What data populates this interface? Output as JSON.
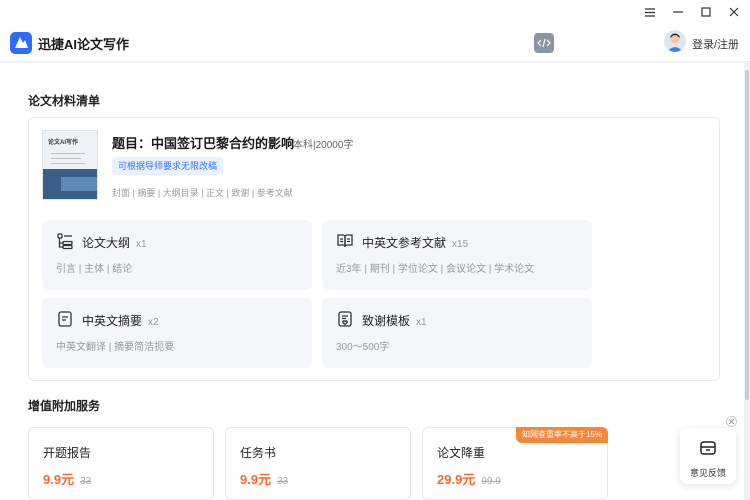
{
  "app": {
    "title": "迅捷AI论文写作",
    "login_label": "登录/注册"
  },
  "material": {
    "section_title": "论文材料清单",
    "cover_title": "论文AI写作",
    "paper_title": "题目：中国签订巴黎合约的影响",
    "paper_meta": "本科|20000字",
    "pill": "可根据导师要求无限改稿",
    "parts": "封面 | 摘要 | 大纲目录 | 正文 | 致谢 | 参考文献",
    "cards": [
      {
        "title": "论文大纲",
        "count": "x1",
        "desc": "引言 | 主体 | 结论",
        "icon": "outline-list-icon"
      },
      {
        "title": "中英文参考文献",
        "count": "x15",
        "desc": "近3年 | 期刊 | 学位论文 | 会议论文 | 学术论文",
        "icon": "book-icon"
      },
      {
        "title": "中英文摘要",
        "count": "x2",
        "desc": "中英文翻译 | 摘要简洁扼要",
        "icon": "document-icon"
      },
      {
        "title": "致谢模板",
        "count": "x1",
        "desc": "300～500字",
        "icon": "thanks-template-icon"
      }
    ]
  },
  "addons": {
    "section_title": "增值附加服务",
    "items": [
      {
        "name": "开题报告",
        "price": "9.9元",
        "old_price": "33",
        "badge": ""
      },
      {
        "name": "任务书",
        "price": "9.9元",
        "old_price": "33",
        "badge": ""
      },
      {
        "name": "论文降重",
        "price": "29.9元",
        "old_price": "99.9",
        "badge": "知网查重率不高于15%"
      }
    ]
  },
  "feedback": {
    "label": "意见反馈"
  },
  "colors": {
    "accent": "#2f6bff",
    "price": "#f36b2c",
    "badge": "#f5873b"
  }
}
